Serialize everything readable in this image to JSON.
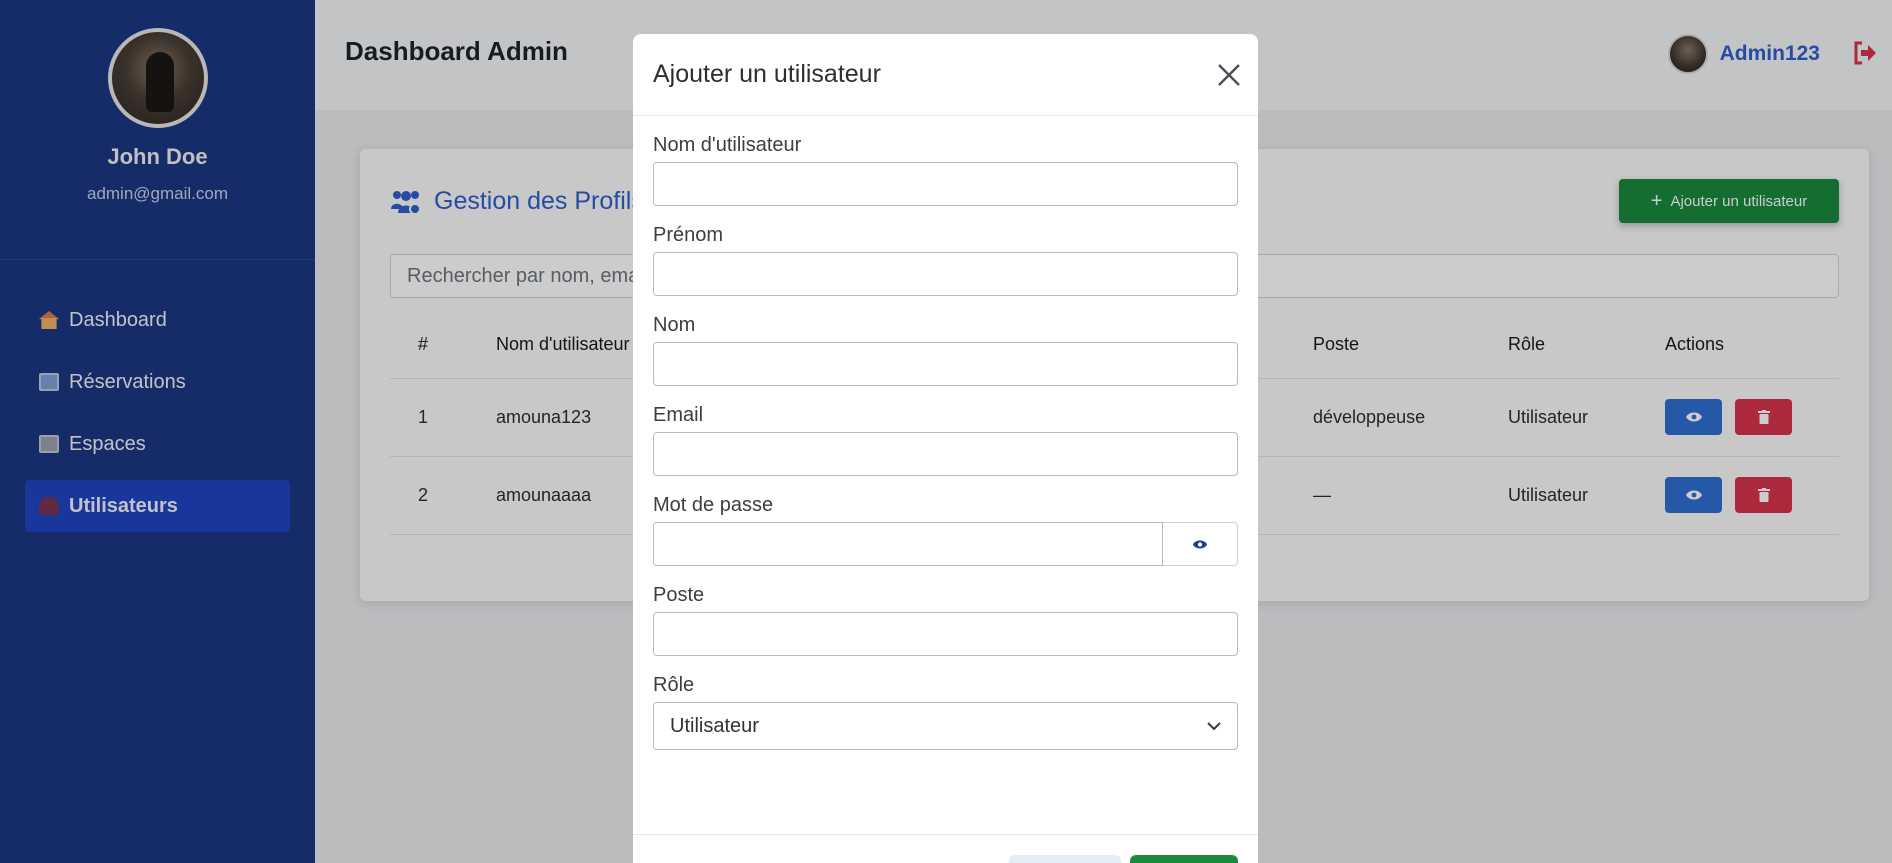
{
  "sidebar": {
    "profile_name": "John Doe",
    "profile_email": "admin@gmail.com",
    "items": [
      {
        "label": "Dashboard",
        "icon": "home-icon"
      },
      {
        "label": "Réservations",
        "icon": "calendar-icon"
      },
      {
        "label": "Espaces",
        "icon": "building-icon"
      },
      {
        "label": "Utilisateurs",
        "icon": "users-icon",
        "active": true
      }
    ]
  },
  "header": {
    "title": "Dashboard Admin",
    "username": "Admin123"
  },
  "card": {
    "title": "Gestion des Profils",
    "add_button_label": "Ajouter un utilisateur",
    "search_placeholder": "Rechercher par nom, ema",
    "columns": [
      "#",
      "Nom d'utilisateur",
      "Poste",
      "Rôle",
      "Actions"
    ],
    "rows": [
      {
        "num": "1",
        "username": "amouna123",
        "poste": "développeuse",
        "role": "Utilisateur"
      },
      {
        "num": "2",
        "username": "amounaaaa",
        "poste": "—",
        "role": "Utilisateur"
      }
    ]
  },
  "modal": {
    "title": "Ajouter un utilisateur",
    "fields": {
      "username": {
        "label": "Nom d'utilisateur",
        "value": ""
      },
      "prenom": {
        "label": "Prénom",
        "value": ""
      },
      "nom": {
        "label": "Nom",
        "value": ""
      },
      "email": {
        "label": "Email",
        "value": ""
      },
      "password": {
        "label": "Mot de passe",
        "value": ""
      },
      "poste": {
        "label": "Poste",
        "value": ""
      },
      "role": {
        "label": "Rôle",
        "value": "Utilisateur"
      }
    }
  },
  "colors": {
    "sidebar": "#1c3782",
    "active_nav": "#1e44c2",
    "accent_blue": "#2f5fcc",
    "success": "#198a3e",
    "danger": "#d8344d"
  }
}
